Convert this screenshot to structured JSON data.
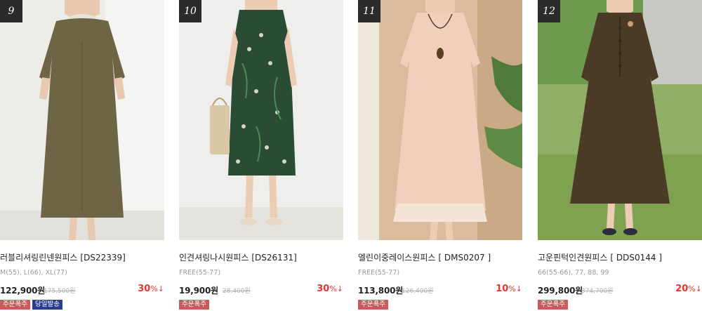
{
  "colors": {
    "rank_bg": "#2b2b2b",
    "discount": "#e9352f",
    "badge_order": "#c95b5b",
    "badge_sameday": "#2a3d8f"
  },
  "products": [
    {
      "rank": "9",
      "name": "러블리셔링린넨원피스",
      "code": "[DS22339]",
      "sizes": "M(55), L(66), XL(77)",
      "price": "122,900원",
      "original_price": "175,500원",
      "discount": "30",
      "discount_unit": "%",
      "discount_icon": "down-arrow-icon",
      "badges": [
        {
          "label": "주문폭주",
          "type": "order"
        },
        {
          "label": "당일발송",
          "type": "sameday"
        }
      ]
    },
    {
      "rank": "10",
      "name": "인견셔링나시원피스",
      "code": "[DS26131]",
      "sizes": "FREE(55-77)",
      "price": "19,900원",
      "original_price": "28,400원",
      "discount": "30",
      "discount_unit": "%",
      "discount_icon": "down-arrow-icon",
      "badges": [
        {
          "label": "주문폭주",
          "type": "order"
        }
      ]
    },
    {
      "rank": "11",
      "name": "엘린이중레이스원피스",
      "code": "[ DMS0207 ]",
      "sizes": "FREE(55-77)",
      "price": "113,800원",
      "original_price": "126,400원",
      "discount": "10",
      "discount_unit": "%",
      "discount_icon": "down-arrow-icon",
      "badges": [
        {
          "label": "주문폭주",
          "type": "order"
        }
      ]
    },
    {
      "rank": "12",
      "name": "고운핀턱인견원피스",
      "code": "[ DDS0144 ]",
      "sizes": "66(55-66), 77, 88, 99",
      "price": "299,800원",
      "original_price": "374,700원",
      "discount": "20",
      "discount_unit": "%",
      "discount_icon": "down-arrow-icon",
      "badges": [
        {
          "label": "주문폭주",
          "type": "order"
        }
      ]
    }
  ]
}
